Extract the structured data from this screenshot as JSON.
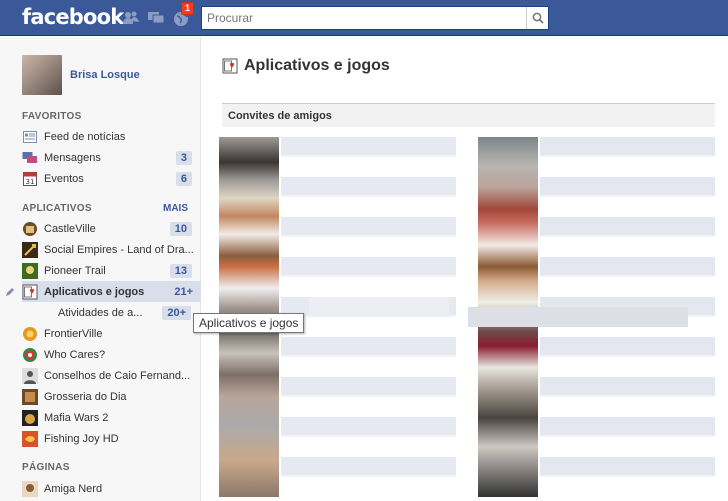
{
  "header": {
    "logo": "facebook",
    "notification_count": "1",
    "search_placeholder": "Procurar"
  },
  "profile": {
    "name": "Brisa Losque"
  },
  "sidebar": {
    "favoritos_title": "FAVORITOS",
    "favoritos": [
      {
        "label": "Feed de notícias",
        "count": "",
        "icon": "news-feed-icon"
      },
      {
        "label": "Mensagens",
        "count": "3",
        "icon": "messages-icon"
      },
      {
        "label": "Eventos",
        "count": "6",
        "icon": "calendar-icon"
      }
    ],
    "aplicativos_title": "APLICATIVOS",
    "aplicativos_more": "MAIS",
    "aplicativos": [
      {
        "label": "CastleVille",
        "count": "10",
        "icon": "castleville-icon"
      },
      {
        "label": "Social Empires - Land of Dra...",
        "count": "",
        "icon": "social-empires-icon"
      },
      {
        "label": "Pioneer Trail",
        "count": "13",
        "icon": "pioneer-trail-icon"
      },
      {
        "label": "Aplicativos e jogos",
        "count": "21+",
        "icon": "apps-games-icon"
      },
      {
        "label": "Atividades de a...",
        "count": "20+",
        "icon": ""
      },
      {
        "label": "FrontierVille",
        "count": "",
        "icon": "frontierville-icon"
      },
      {
        "label": "Who Cares?",
        "count": "",
        "icon": "who-cares-icon"
      },
      {
        "label": "Conselhos de Caio Fernand...",
        "count": "",
        "icon": "conselhos-icon"
      },
      {
        "label": "Grosseria do Dia",
        "count": "",
        "icon": "grosseria-icon"
      },
      {
        "label": "Mafia Wars 2",
        "count": "",
        "icon": "mafia-wars-icon"
      },
      {
        "label": "Fishing Joy HD",
        "count": "",
        "icon": "fishing-joy-icon"
      }
    ],
    "paginas_title": "PÁGINAS",
    "paginas": [
      {
        "label": "Amiga Nerd",
        "icon": "amiga-nerd-icon"
      }
    ]
  },
  "tooltip": "Aplicativos e jogos",
  "main": {
    "title": "Aplicativos e jogos",
    "section": "Convites de amigos"
  },
  "colors": {
    "brand": "#3b5998",
    "badge": "#f03d25",
    "selected_bg": "#d8dfea"
  }
}
